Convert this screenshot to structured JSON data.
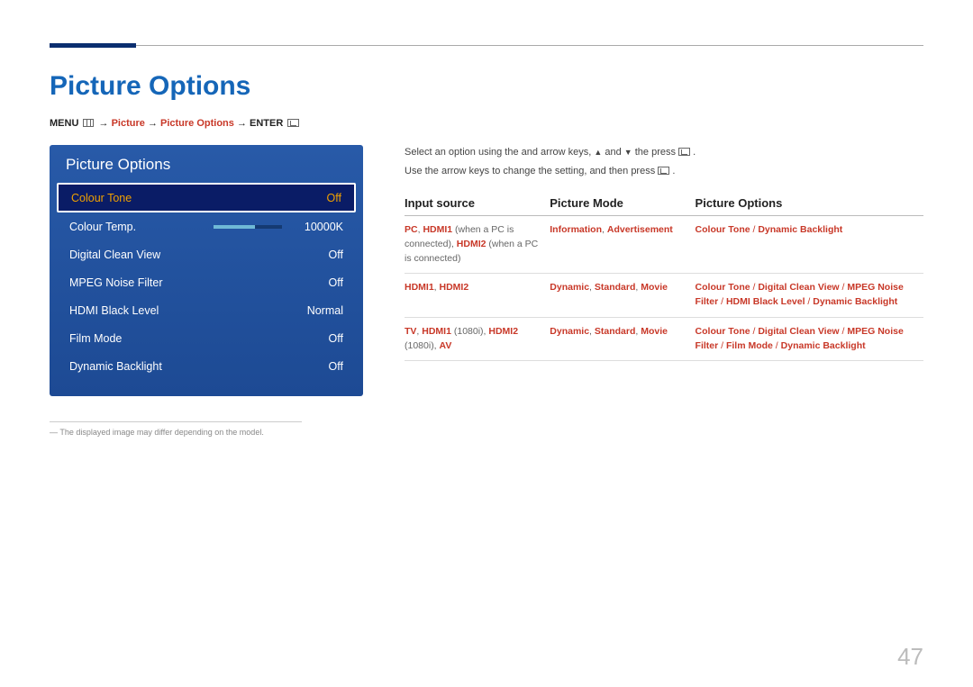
{
  "title": "Picture Options",
  "breadcrumb": {
    "menu": "MENU",
    "picture": "Picture",
    "picture_options": "Picture Options",
    "enter": "ENTER"
  },
  "tv_panel": {
    "header": "Picture Options",
    "items": [
      {
        "label": "Colour Tone",
        "value": "Off",
        "selected": true
      },
      {
        "label": "Colour Temp.",
        "value": "10000K",
        "slider": true
      },
      {
        "label": "Digital Clean View",
        "value": "Off"
      },
      {
        "label": "MPEG Noise Filter",
        "value": "Off"
      },
      {
        "label": "HDMI Black Level",
        "value": "Normal"
      },
      {
        "label": "Film Mode",
        "value": "Off"
      },
      {
        "label": "Dynamic Backlight",
        "value": "Off"
      }
    ]
  },
  "note": "The displayed image may differ depending on the model.",
  "instructions": {
    "line1_pre": "Select an option using the and arrow keys, ",
    "line1_post": " the press ",
    "line1_and": " and ",
    "line2_pre": "Use the arrow keys to change the setting, and then press ",
    "period": "."
  },
  "table": {
    "headers": [
      "Input source",
      "Picture Mode",
      "Picture Options"
    ],
    "rows": [
      {
        "c1": [
          {
            "t": "PC",
            "c": "red"
          },
          {
            "t": ", ",
            "c": "gray"
          },
          {
            "t": "HDMI1",
            "c": "red"
          },
          {
            "t": " (when a PC is connected), ",
            "c": "gray"
          },
          {
            "t": "HDMI2",
            "c": "red"
          },
          {
            "t": " (when a PC is connected)",
            "c": "gray"
          }
        ],
        "c2": [
          {
            "t": "Information",
            "c": "red"
          },
          {
            "t": ", ",
            "c": "gray"
          },
          {
            "t": "Advertisement",
            "c": "red"
          }
        ],
        "c3": [
          {
            "t": "Colour Tone",
            "c": "red"
          },
          {
            "t": " / ",
            "c": "sep"
          },
          {
            "t": "Dynamic Backlight",
            "c": "red"
          }
        ]
      },
      {
        "c1": [
          {
            "t": "HDMI1",
            "c": "red"
          },
          {
            "t": ", ",
            "c": "gray"
          },
          {
            "t": "HDMI2",
            "c": "red"
          }
        ],
        "c2": [
          {
            "t": "Dynamic",
            "c": "red"
          },
          {
            "t": ", ",
            "c": "gray"
          },
          {
            "t": "Standard",
            "c": "red"
          },
          {
            "t": ", ",
            "c": "gray"
          },
          {
            "t": "Movie",
            "c": "red"
          }
        ],
        "c3": [
          {
            "t": "Colour Tone",
            "c": "red"
          },
          {
            "t": " / ",
            "c": "sep"
          },
          {
            "t": "Digital Clean View",
            "c": "red"
          },
          {
            "t": " / ",
            "c": "sep"
          },
          {
            "t": "MPEG Noise Filter",
            "c": "red"
          },
          {
            "t": " / ",
            "c": "sep"
          },
          {
            "t": "HDMI Black Level",
            "c": "red"
          },
          {
            "t": " / ",
            "c": "sep"
          },
          {
            "t": "Dynamic Backlight",
            "c": "red"
          }
        ]
      },
      {
        "c1": [
          {
            "t": "TV",
            "c": "red"
          },
          {
            "t": ", ",
            "c": "gray"
          },
          {
            "t": "HDMI1",
            "c": "red"
          },
          {
            "t": " (1080i), ",
            "c": "gray"
          },
          {
            "t": "HDMI2",
            "c": "red"
          },
          {
            "t": " (1080i), ",
            "c": "gray"
          },
          {
            "t": "AV",
            "c": "red"
          }
        ],
        "c2": [
          {
            "t": "Dynamic",
            "c": "red"
          },
          {
            "t": ", ",
            "c": "gray"
          },
          {
            "t": "Standard",
            "c": "red"
          },
          {
            "t": ", ",
            "c": "gray"
          },
          {
            "t": "Movie",
            "c": "red"
          }
        ],
        "c3": [
          {
            "t": "Colour Tone",
            "c": "red"
          },
          {
            "t": " / ",
            "c": "sep"
          },
          {
            "t": "Digital Clean View",
            "c": "red"
          },
          {
            "t": " / ",
            "c": "sep"
          },
          {
            "t": "MPEG Noise Filter",
            "c": "red"
          },
          {
            "t": " / ",
            "c": "sep"
          },
          {
            "t": "Film Mode",
            "c": "red"
          },
          {
            "t": " / ",
            "c": "sep"
          },
          {
            "t": "Dynamic Backlight",
            "c": "red"
          }
        ]
      }
    ]
  },
  "page_number": "47"
}
